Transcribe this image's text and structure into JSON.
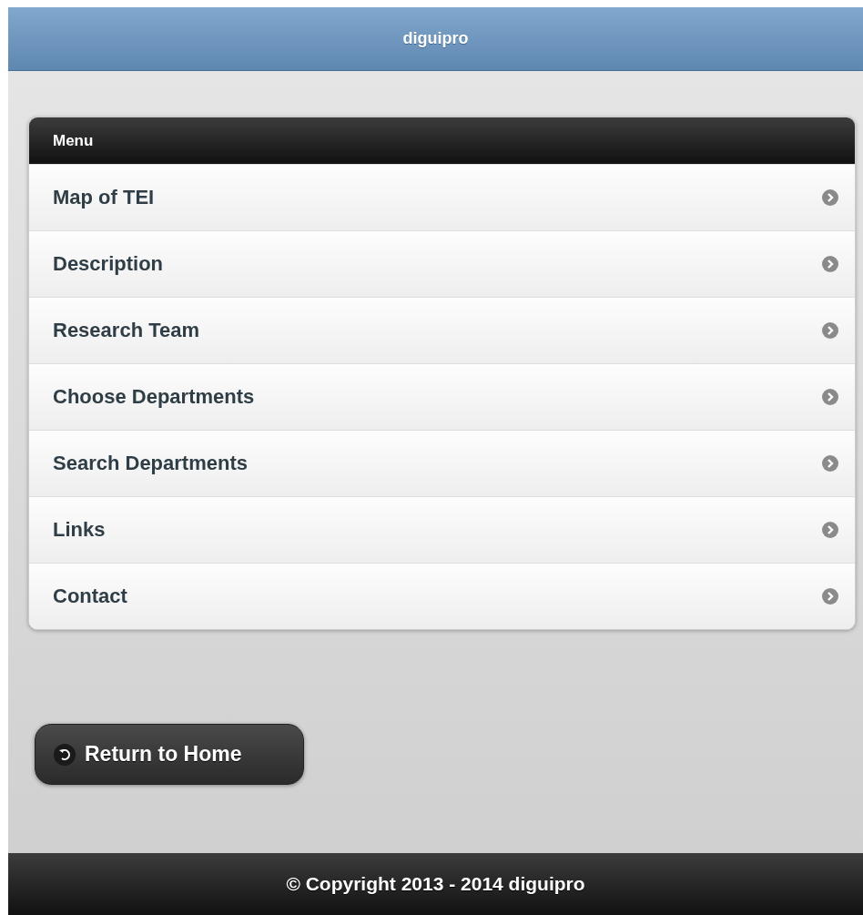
{
  "header": {
    "title": "diguipro"
  },
  "menu": {
    "title": "Menu",
    "items": [
      {
        "label": "Map of TEI"
      },
      {
        "label": "Description"
      },
      {
        "label": "Research Team"
      },
      {
        "label": "Choose Departments"
      },
      {
        "label": "Search Departments"
      },
      {
        "label": "Links"
      },
      {
        "label": "Contact"
      }
    ]
  },
  "return_button": {
    "label": "Return to Home"
  },
  "footer": {
    "text": "© Copyright 2013 - 2014 diguipro"
  }
}
